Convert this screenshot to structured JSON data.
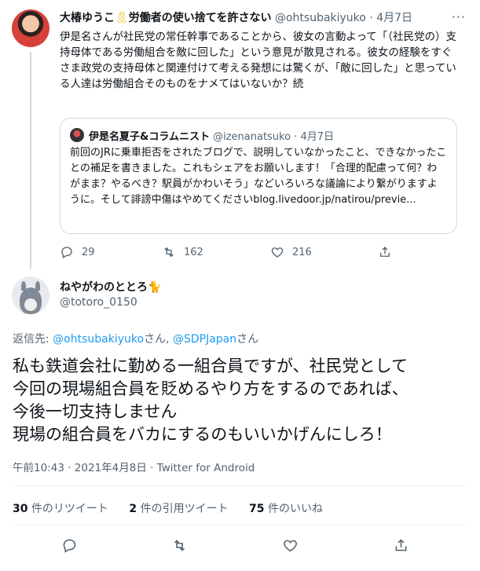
{
  "top_tweet": {
    "display_name": "大椿ゆうこ",
    "ribbon": "🎗",
    "name_suffix": "労働者の使い捨てを許さない",
    "handle": "@ohtsubakiyuko",
    "dot": "·",
    "date": "4月7日",
    "more": "···",
    "body": "伊是名さんが社民党の常任幹事であることから、彼女の言動よって「（社民党の）支持母体である労働組合を敵に回した」という意見が散見される。彼女の経験をすぐさま政党の支持母体と関連付けて考える発想には驚くが、「敵に回した」と思っている人達は労働組合そのものをナメてはいないか？続",
    "quote": {
      "name": "伊是名夏子&コラムニスト",
      "handle": "@izenanatsuko",
      "date": "4月7日",
      "body": "前回のJRに乗車拒否をされたブログで、説明していなかったこと、できなかったことの補足を書きました。これもシェアをお願いします！「合理的配慮って何？わがまま？やるべき？駅員がかわいそう」などいろいろな議論により繋がりますように。そして誹謗中傷はやめてくださいblog.livedoor.jp/natirou/previe..."
    },
    "actions": {
      "reply_count": "29",
      "retweet_count": "162",
      "like_count": "216"
    }
  },
  "main_tweet": {
    "display_name": "ねやがわのととろ🐈",
    "handle": "@totoro_0150",
    "reply_prefix": "返信先: ",
    "reply_handle_1": "@ohtsubakiyuko",
    "reply_san_1": "さん, ",
    "reply_handle_2": "@SDPJapan",
    "reply_san_2": "さん",
    "body_lines": [
      "私も鉄道会社に勤める一組合員ですが、社民党として",
      "今回の現場組合員を貶めるやり方をするのであれば、",
      "今後一切支持しません",
      "現場の組合員をバカにするのもいいかげんにしろ！"
    ],
    "meta": "午前10:43 · 2021年4月8日 · Twitter for Android",
    "stats": {
      "retweets_num": "30",
      "retweets_label": " 件のリツイート",
      "quotes_num": "2",
      "quotes_label": " 件の引用ツイート",
      "likes_num": "75",
      "likes_label": " 件のいいね"
    }
  },
  "colors": {
    "link": "#1d9bf0",
    "muted": "#536471",
    "text": "#0f1419",
    "border": "#cfd9de"
  }
}
